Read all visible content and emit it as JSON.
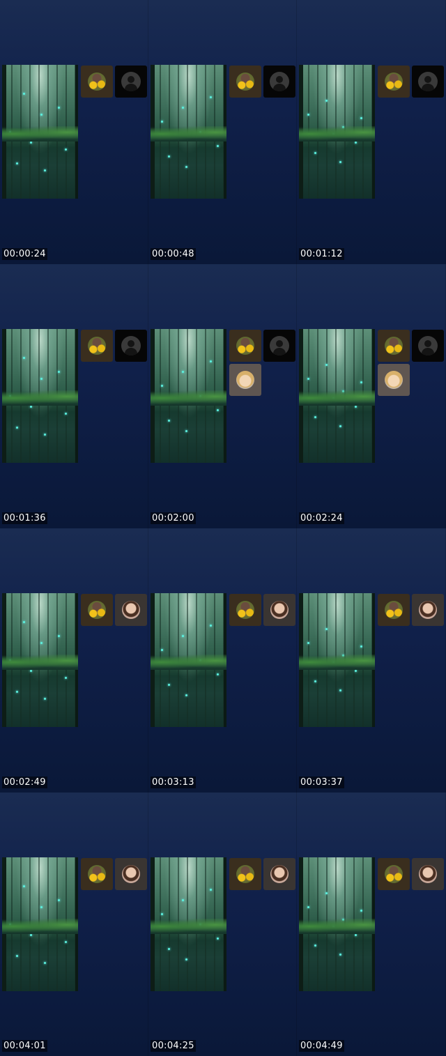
{
  "colors": {
    "background": "#0c1838",
    "firefly": "#5cf3e0",
    "timestamp_text": "#ffffff"
  },
  "icons": {
    "flowers_avatar": "flower-avatar-icon",
    "placeholder_avatar": "person-silhouette-icon",
    "person_avatar": "person-photo-avatar-icon",
    "cartoon_avatar": "cartoon-face-avatar-icon"
  },
  "frames": [
    {
      "time": "00:00:24",
      "participants": [
        "flowers",
        "placeholder"
      ]
    },
    {
      "time": "00:00:48",
      "participants": [
        "flowers",
        "placeholder"
      ]
    },
    {
      "time": "00:01:12",
      "participants": [
        "flowers",
        "placeholder"
      ]
    },
    {
      "time": "00:01:36",
      "participants": [
        "flowers",
        "placeholder"
      ]
    },
    {
      "time": "00:02:00",
      "participants": [
        "flowers",
        "placeholder",
        "cartoon"
      ]
    },
    {
      "time": "00:02:24",
      "participants": [
        "flowers",
        "placeholder",
        "cartoon"
      ]
    },
    {
      "time": "00:02:49",
      "participants": [
        "flowers",
        "person"
      ]
    },
    {
      "time": "00:03:13",
      "participants": [
        "flowers",
        "person"
      ]
    },
    {
      "time": "00:03:37",
      "participants": [
        "flowers",
        "person"
      ]
    },
    {
      "time": "00:04:01",
      "participants": [
        "flowers",
        "person"
      ]
    },
    {
      "time": "00:04:25",
      "participants": [
        "flowers",
        "person"
      ]
    },
    {
      "time": "00:04:49",
      "participants": [
        "flowers",
        "person"
      ]
    }
  ]
}
